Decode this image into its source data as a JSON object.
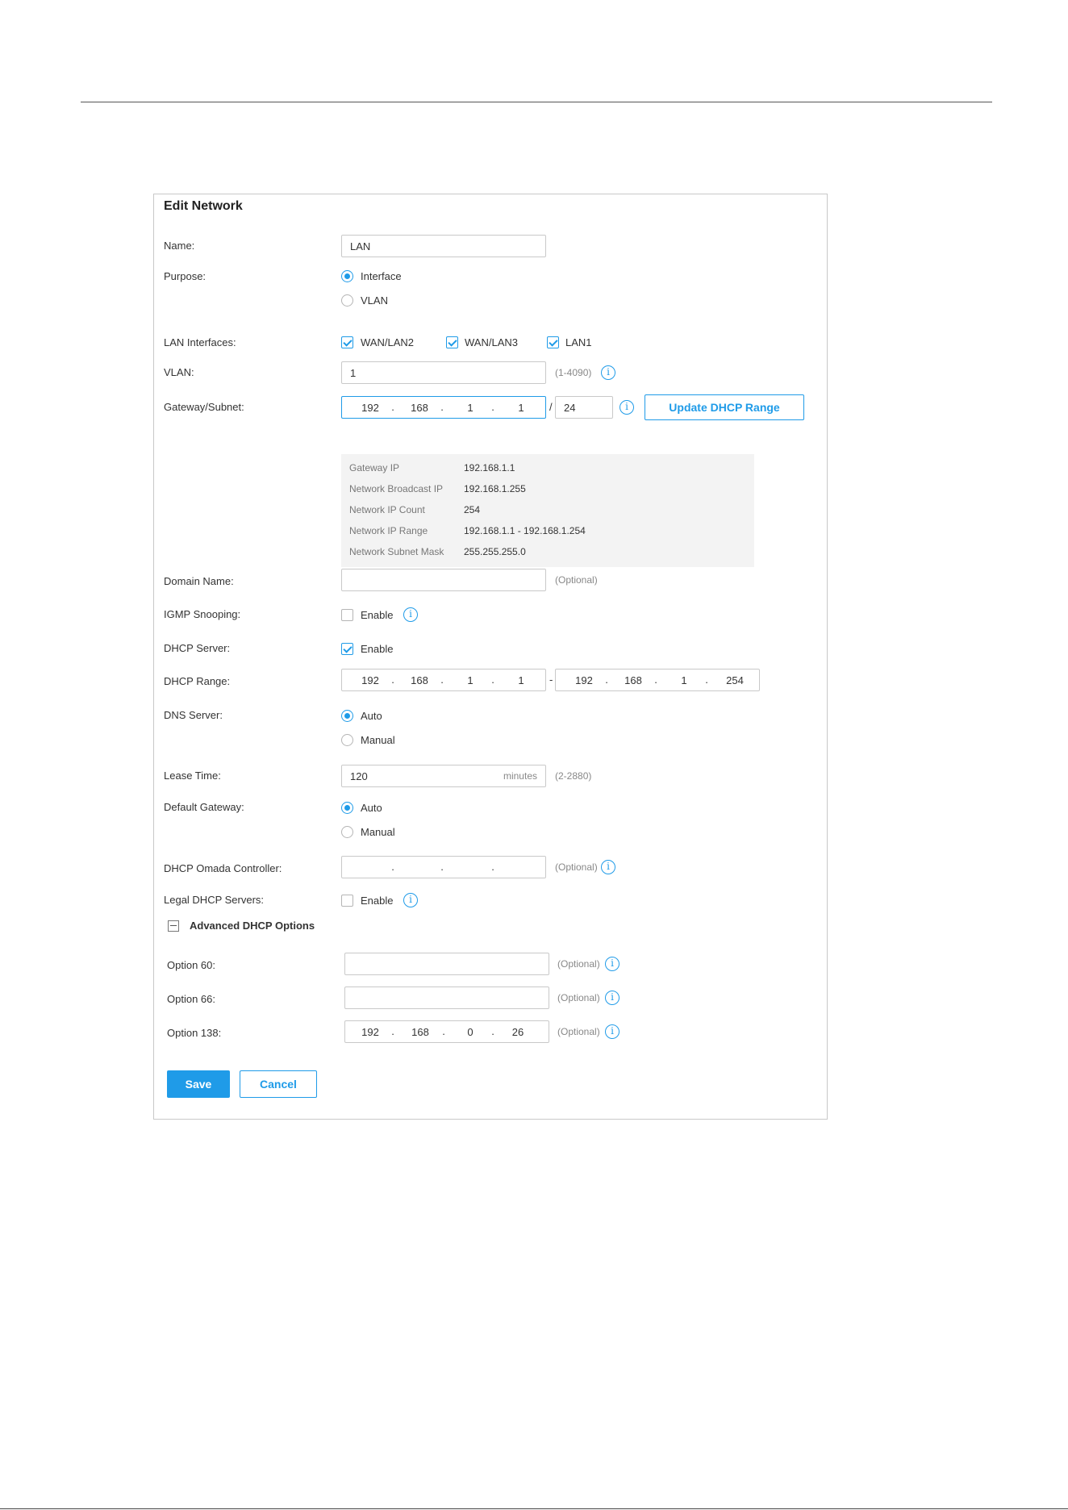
{
  "title": "Edit Network",
  "name": {
    "label": "Name:",
    "value": "LAN"
  },
  "purpose": {
    "label": "Purpose:",
    "options": [
      "Interface",
      "VLAN"
    ],
    "selected": "Interface"
  },
  "lan_interfaces": {
    "label": "LAN Interfaces:",
    "items": [
      {
        "label": "WAN/LAN2",
        "checked": true
      },
      {
        "label": "WAN/LAN3",
        "checked": true
      },
      {
        "label": "LAN1",
        "checked": true
      }
    ]
  },
  "vlan": {
    "label": "VLAN:",
    "value": "1",
    "hint": "(1-4090)"
  },
  "gateway": {
    "label": "Gateway/Subnet:",
    "ip": [
      "192",
      "168",
      "1",
      "1"
    ],
    "separator": "/",
    "mask": "24",
    "update_button": "Update DHCP Range"
  },
  "summary": [
    {
      "key": "Gateway IP",
      "value": "192.168.1.1"
    },
    {
      "key": "Network Broadcast IP",
      "value": "192.168.1.255"
    },
    {
      "key": "Network IP Count",
      "value": "254"
    },
    {
      "key": "Network IP Range",
      "value": "192.168.1.1 - 192.168.1.254"
    },
    {
      "key": "Network Subnet Mask",
      "value": "255.255.255.0"
    }
  ],
  "domain_name": {
    "label": "Domain Name:",
    "value": "",
    "hint": "(Optional)"
  },
  "igmp": {
    "label": "IGMP Snooping:",
    "option": "Enable",
    "checked": false
  },
  "dhcp_server": {
    "label": "DHCP Server:",
    "option": "Enable",
    "checked": true
  },
  "dhcp_range": {
    "label": "DHCP Range:",
    "start": [
      "192",
      "168",
      "1",
      "1"
    ],
    "separator": "-",
    "end": [
      "192",
      "168",
      "1",
      "254"
    ]
  },
  "dns_server": {
    "label": "DNS Server:",
    "options": [
      "Auto",
      "Manual"
    ],
    "selected": "Auto"
  },
  "lease_time": {
    "label": "Lease Time:",
    "value": "120",
    "unit": "minutes",
    "hint": "(2-2880)"
  },
  "default_gateway": {
    "label": "Default Gateway:",
    "options": [
      "Auto",
      "Manual"
    ],
    "selected": "Auto"
  },
  "omada_controller": {
    "label": "DHCP Omada Controller:",
    "hint": "(Optional)"
  },
  "legal_dhcp": {
    "label": "Legal DHCP Servers:",
    "option": "Enable",
    "checked": false
  },
  "advanced": {
    "title": "Advanced DHCP Options",
    "option60": {
      "label": "Option 60:",
      "value": "",
      "hint": "(Optional)"
    },
    "option66": {
      "label": "Option 66:",
      "value": "",
      "hint": "(Optional)"
    },
    "option138": {
      "label": "Option 138:",
      "ip": [
        "192",
        "168",
        "0",
        "26"
      ],
      "hint": "(Optional)"
    }
  },
  "buttons": {
    "save": "Save",
    "cancel": "Cancel"
  },
  "dot": ".",
  "info_glyph": "i",
  "colors": {
    "accent": "#1f9be8",
    "summary_bg": "#f3f3f3"
  }
}
